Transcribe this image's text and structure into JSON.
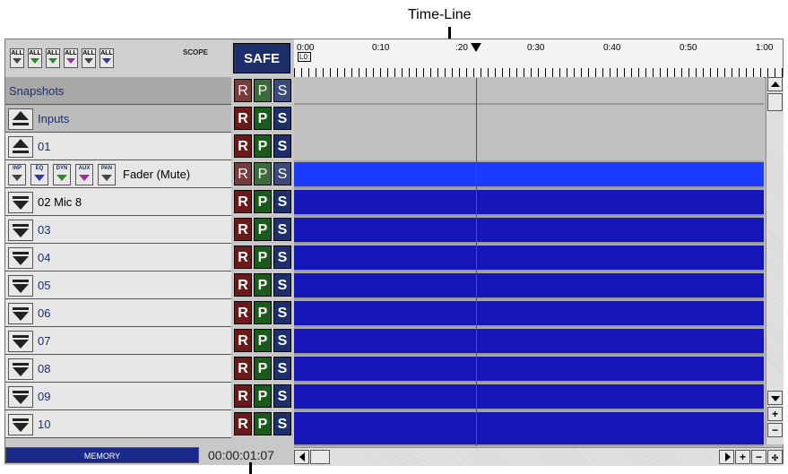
{
  "callout": {
    "label": "Time-Line"
  },
  "toolbar": {
    "scope_buttons": [
      "ALL",
      "ALL",
      "ALL",
      "ALL",
      "ALL",
      "ALL"
    ],
    "scope_label": "SCOPE",
    "safe_label": "SAFE"
  },
  "ruler": {
    "ticks": [
      "0:00",
      "0:10",
      ":20",
      "0:30",
      "0:40",
      "0:50",
      "1:00"
    ],
    "lo_label": "L0:"
  },
  "rows": [
    {
      "label": "Snapshots"
    },
    {
      "label": "Inputs"
    },
    {
      "label": "01"
    },
    {
      "label": "Fader (Mute)"
    },
    {
      "label": "02  Mic 8"
    },
    {
      "label": "03"
    },
    {
      "label": "04"
    },
    {
      "label": "05"
    },
    {
      "label": "06"
    },
    {
      "label": "07"
    },
    {
      "label": "08"
    },
    {
      "label": "09"
    },
    {
      "label": "10"
    }
  ],
  "plugin_buttons": [
    "INP",
    "EQ",
    "DYN",
    "AUX",
    "PAN"
  ],
  "rps": {
    "r": "R",
    "p": "P",
    "s": "S"
  },
  "memory": {
    "label": "MEMORY"
  },
  "timecode": "00:00:01:07",
  "scroll": {
    "plus": "+",
    "minus": "−"
  },
  "colors": {
    "track_blue": "#1515b8",
    "selected_blue": "#1a3bff",
    "safe_bg": "#1d2f6b"
  }
}
